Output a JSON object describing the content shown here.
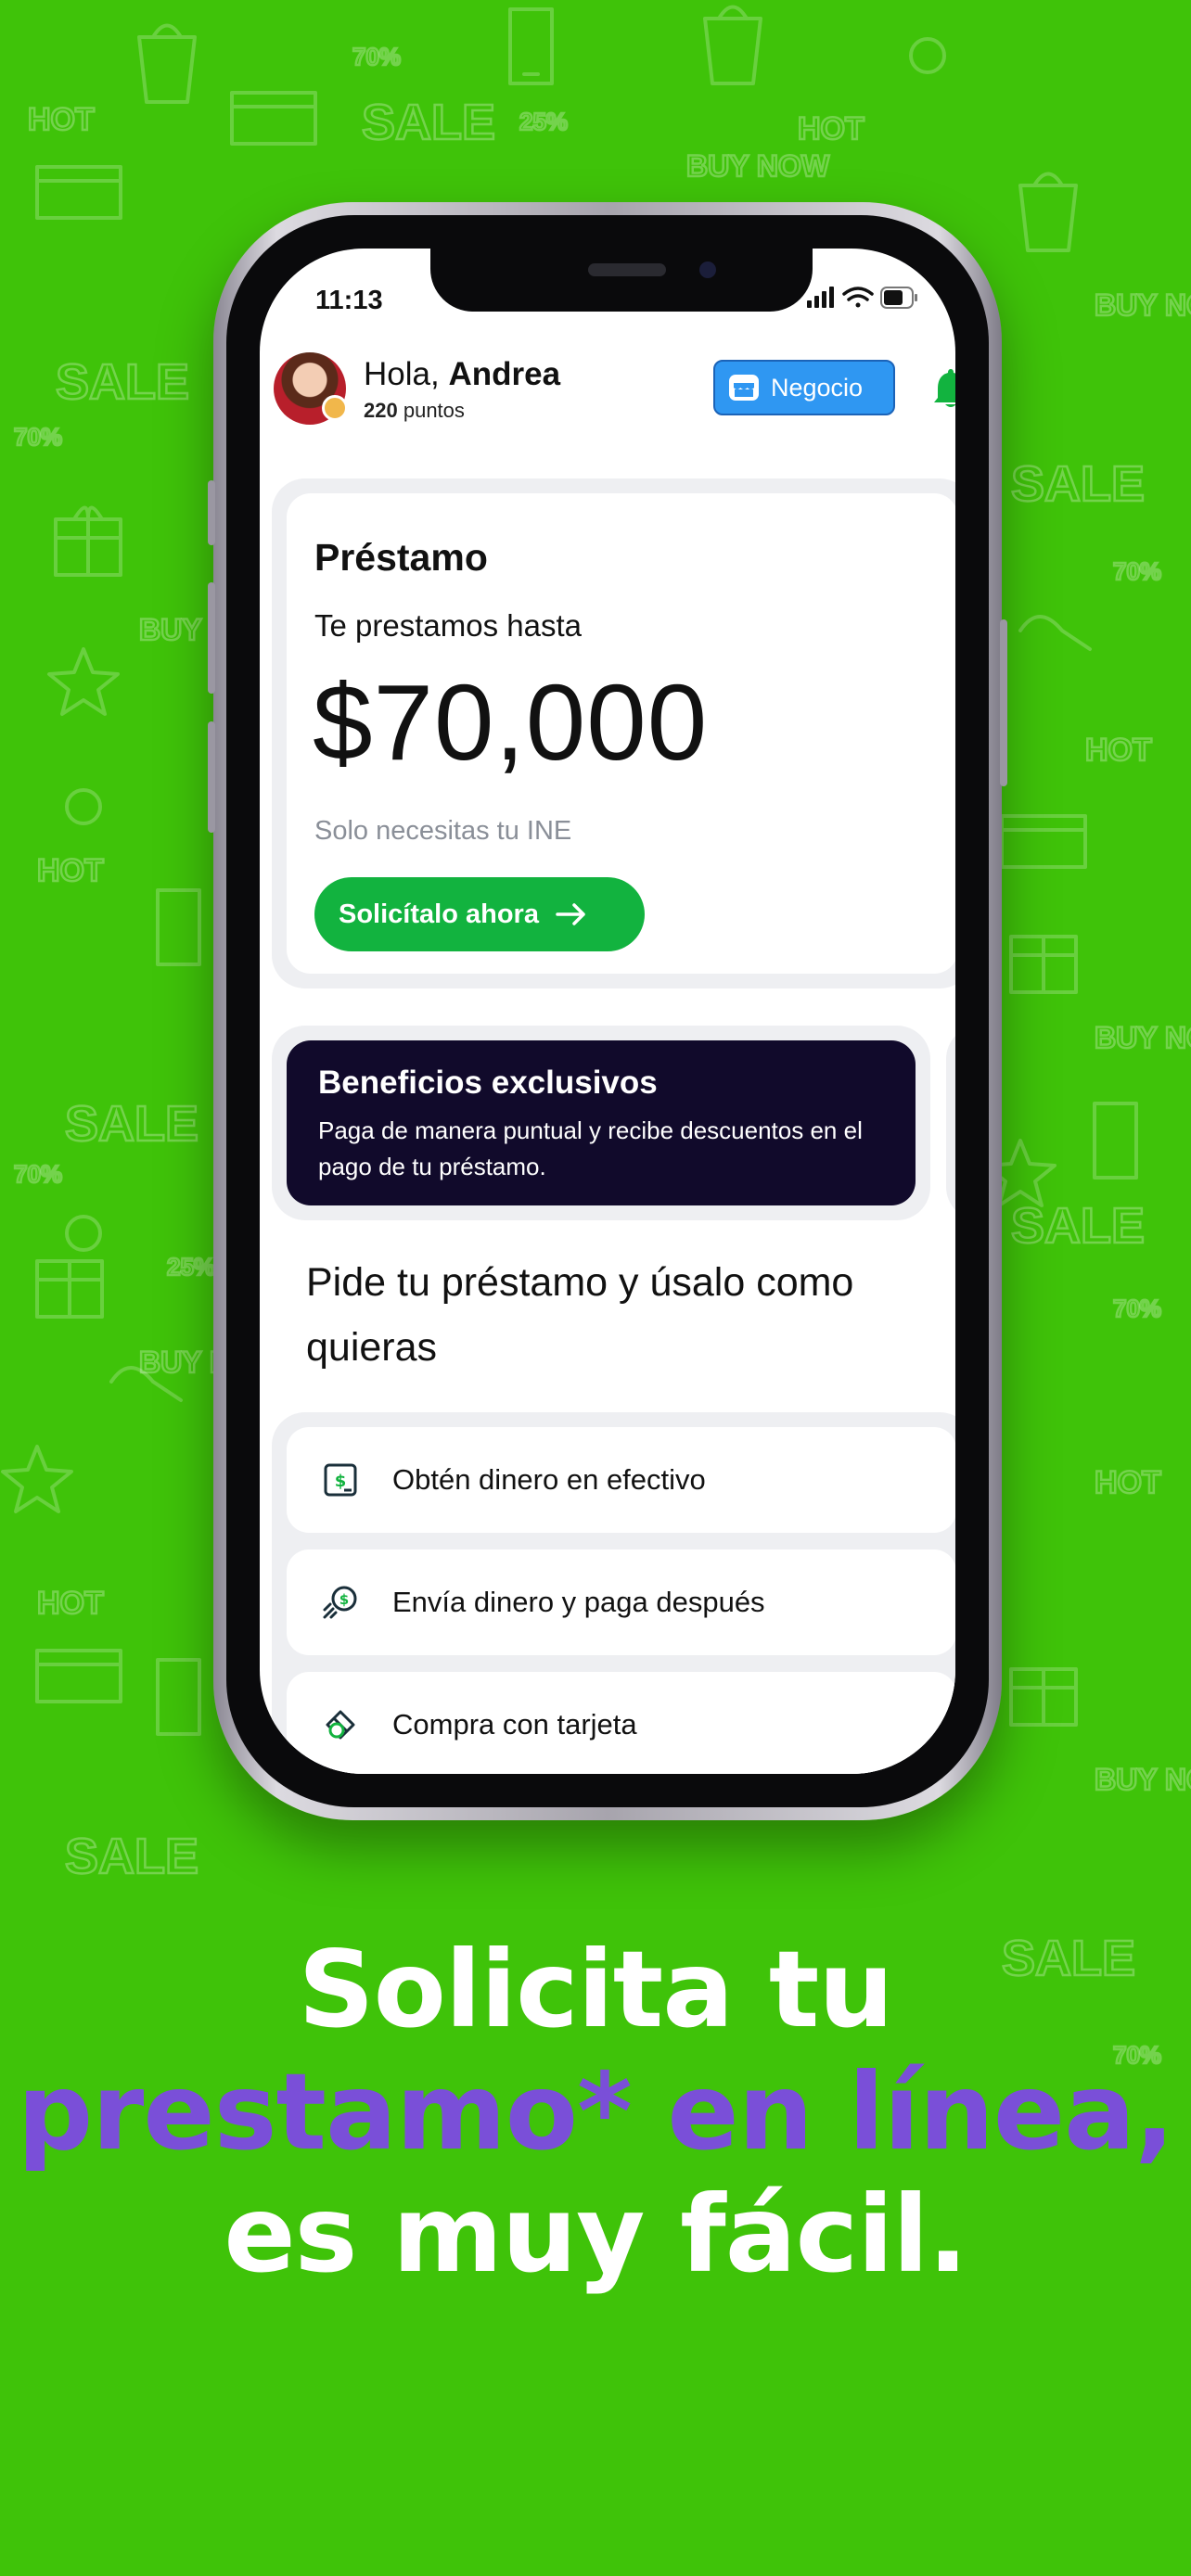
{
  "colors": {
    "background": "#3fc309",
    "accent_green": "#12b33f",
    "negocio_blue": "#2f97f2",
    "benefits_dark": "#110a2b",
    "headline_purple": "#7a4fd8",
    "headline_white": "#ffffff"
  },
  "background_doodles": [
    "SALE",
    "HOT",
    "BUY NOW",
    "70%",
    "25%",
    "shopping-bag-icon",
    "gift-icon",
    "credit-card-icon",
    "phone-icon",
    "high-heel-icon",
    "star-icon",
    "ring-icon"
  ],
  "status_bar": {
    "time": "11:13",
    "icons": [
      "signal-icon",
      "wifi-icon",
      "battery-icon"
    ]
  },
  "header": {
    "greeting_prefix": "Hola,",
    "user_name": "Andrea",
    "points_value": "220",
    "points_label": "puntos",
    "negocio_label": "Negocio",
    "bell_icon": "bell-icon"
  },
  "loan_card": {
    "title": "Préstamo",
    "subtitle": "Te prestamos hasta",
    "amount": "$70,000",
    "note": "Solo necesitas tu INE",
    "cta_label": "Solicítalo ahora"
  },
  "benefits_card": {
    "title": "Beneficios exclusivos",
    "text": "Paga de manera puntual y recibe descuentos en el pago de tu préstamo."
  },
  "section_title": "Pide tu préstamo y úsalo como quieras",
  "options": [
    {
      "label": "Obtén dinero en efectivo",
      "icon": "cash-icon"
    },
    {
      "label": "Envía dinero y paga después",
      "icon": "send-money-icon"
    },
    {
      "label": "Compra con tarjeta",
      "icon": "card-icon"
    }
  ],
  "headline": {
    "line1": "Solicita tu",
    "line2": "prestamo* en línea,",
    "line3": "es muy fácil."
  }
}
